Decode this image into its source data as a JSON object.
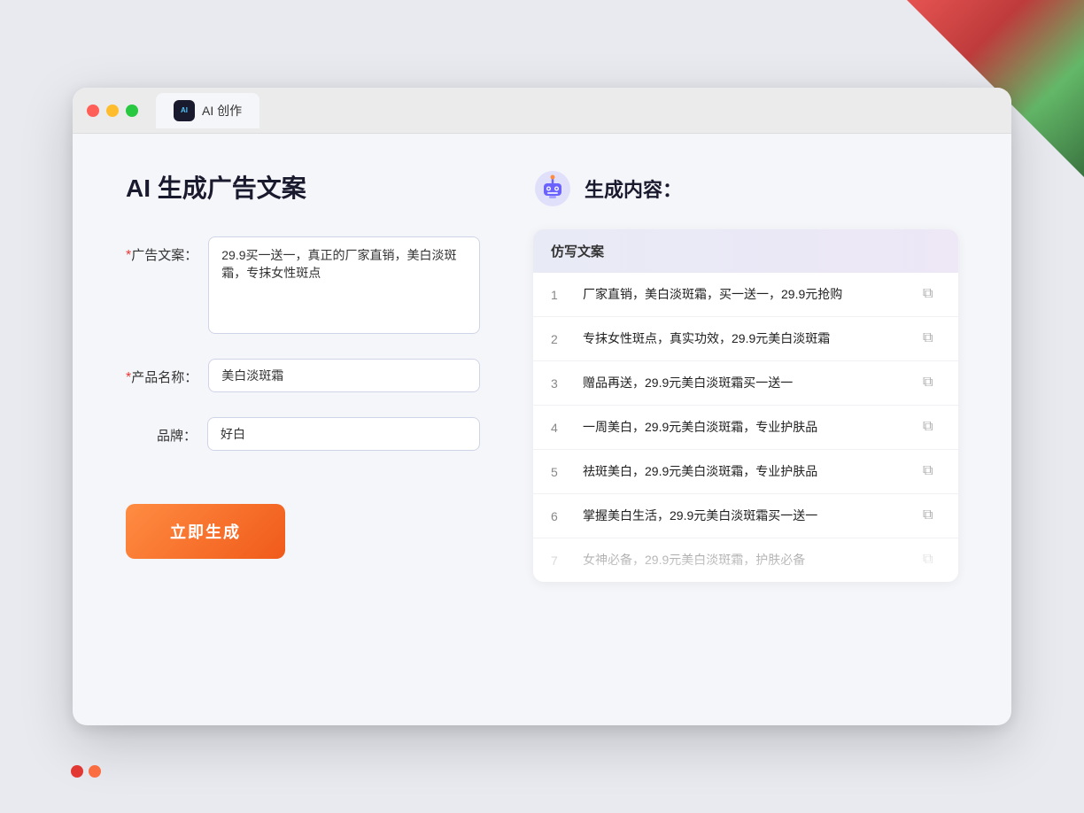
{
  "browser": {
    "tab_label": "AI 创作",
    "traffic_lights": [
      "red",
      "yellow",
      "green"
    ]
  },
  "left_panel": {
    "page_title": "AI 生成广告文案",
    "form": {
      "ad_copy_label": "广告文案：",
      "ad_copy_required": "*",
      "ad_copy_value": "29.9买一送一，真正的厂家直销，美白淡斑霜，专抹女性斑点",
      "product_name_label": "产品名称：",
      "product_name_required": "*",
      "product_name_value": "美白淡斑霜",
      "brand_label": "品牌：",
      "brand_value": "好白"
    },
    "generate_button": "立即生成"
  },
  "right_panel": {
    "section_title": "生成内容：",
    "table_header": "仿写文案",
    "results": [
      {
        "number": "1",
        "text": "厂家直销，美白淡斑霜，买一送一，29.9元抢购"
      },
      {
        "number": "2",
        "text": "专抹女性斑点，真实功效，29.9元美白淡斑霜"
      },
      {
        "number": "3",
        "text": "赠品再送，29.9元美白淡斑霜买一送一"
      },
      {
        "number": "4",
        "text": "一周美白，29.9元美白淡斑霜，专业护肤品"
      },
      {
        "number": "5",
        "text": "祛斑美白，29.9元美白淡斑霜，专业护肤品"
      },
      {
        "number": "6",
        "text": "掌握美白生活，29.9元美白淡斑霜买一送一"
      },
      {
        "number": "7",
        "text": "女神必备，29.9元美白淡斑霜，护肤必备",
        "dimmed": true
      }
    ]
  },
  "icons": {
    "copy": "⧉",
    "robot_color": "#6c63ff"
  }
}
